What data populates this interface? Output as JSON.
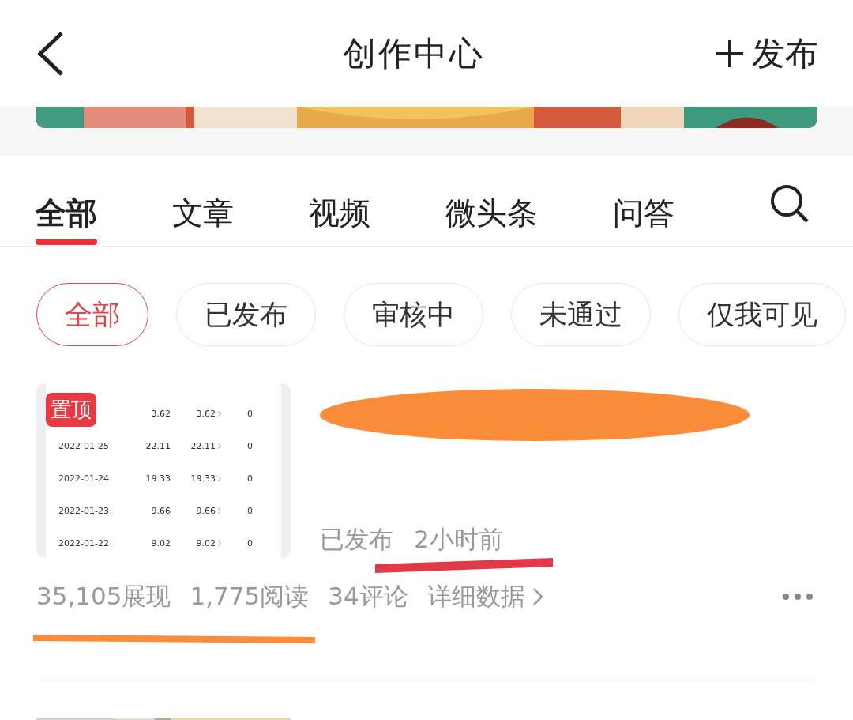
{
  "header": {
    "title": "创作中心",
    "publish": "发布"
  },
  "tabs": [
    {
      "label": "全部",
      "selected": true
    },
    {
      "label": "文章",
      "selected": false
    },
    {
      "label": "视频",
      "selected": false
    },
    {
      "label": "微头条",
      "selected": false
    },
    {
      "label": "问答",
      "selected": false
    }
  ],
  "filters": [
    {
      "label": "全部",
      "selected": true
    },
    {
      "label": "已发布",
      "selected": false
    },
    {
      "label": "审核中",
      "selected": false
    },
    {
      "label": "未通过",
      "selected": false
    },
    {
      "label": "仅我可见",
      "selected": false
    }
  ],
  "articles": [
    {
      "badge": "置顶",
      "thumbnail_rows": [
        {
          "date": "",
          "values": [
            "3.62",
            "3.62",
            "0"
          ]
        },
        {
          "date": "2022-01-25",
          "values": [
            "22.11",
            "22.11",
            "0"
          ]
        },
        {
          "date": "2022-01-24",
          "values": [
            "19.33",
            "19.33",
            "0"
          ]
        },
        {
          "date": "2022-01-23",
          "values": [
            "9.66",
            "9.66",
            "0"
          ]
        },
        {
          "date": "2022-01-22",
          "values": [
            "9.02",
            "9.02",
            "0"
          ]
        }
      ],
      "status": "已发布",
      "time": "2小时前",
      "stats": [
        "35,105展现",
        "1,775阅读",
        "34评论"
      ],
      "details": "详细数据"
    }
  ]
}
